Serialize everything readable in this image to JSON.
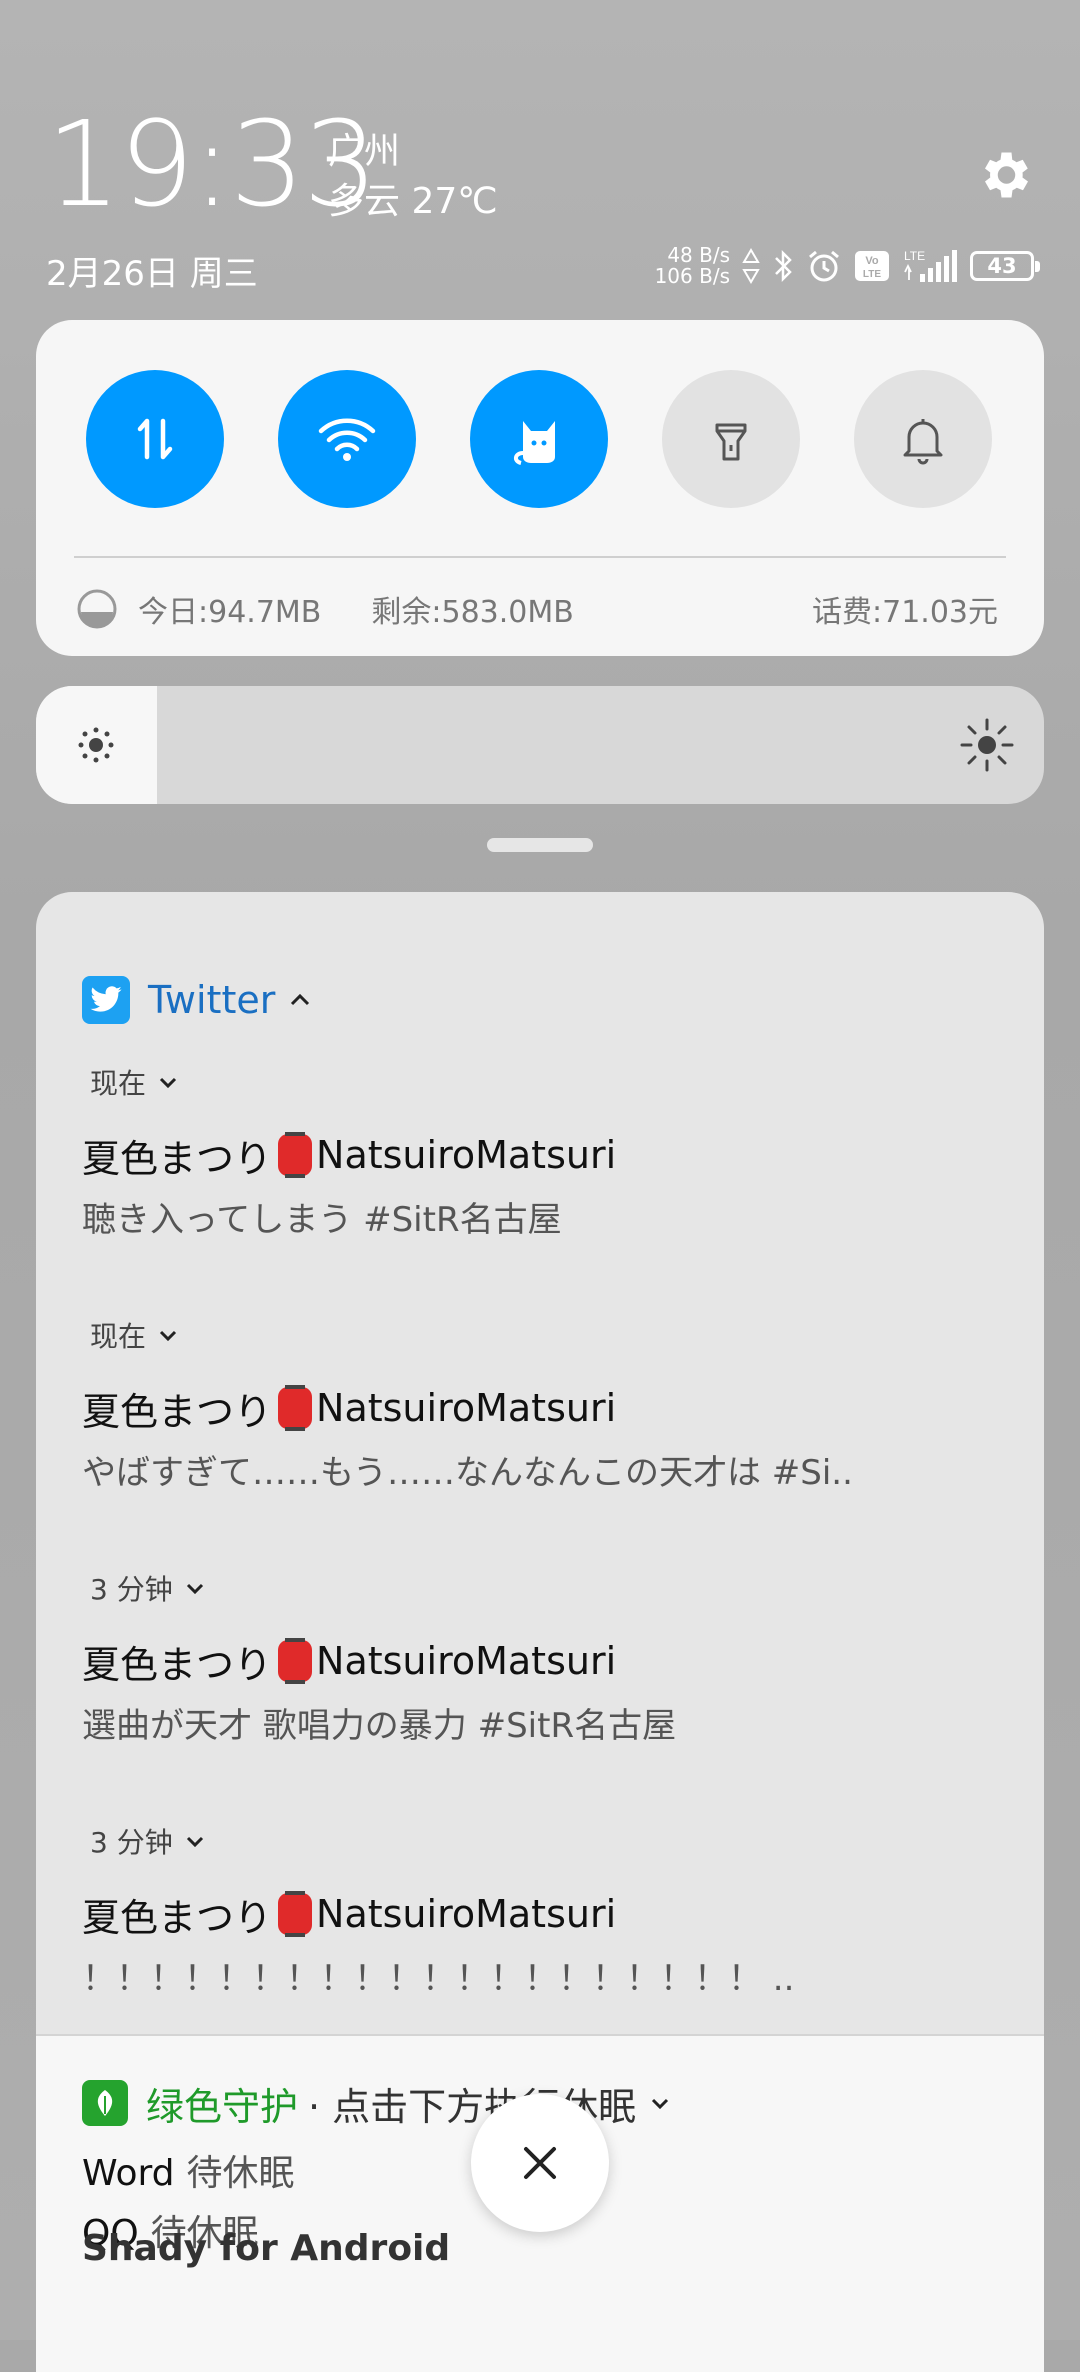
{
  "header": {
    "time": "19:33",
    "city": "广州",
    "weather": "多云 27℃",
    "date": "2月26日 周三",
    "speed_up": "48 B/s",
    "speed_down": "106 B/s",
    "network_label": "LTE",
    "battery": "43"
  },
  "toggles": [
    {
      "name": "mobile-data",
      "icon": "data-arrows-icon",
      "state": "on"
    },
    {
      "name": "wifi",
      "icon": "wifi-icon",
      "state": "on"
    },
    {
      "name": "cat-app",
      "icon": "cat-icon",
      "state": "on"
    },
    {
      "name": "flashlight",
      "icon": "flashlight-icon",
      "state": "off"
    },
    {
      "name": "notifications",
      "icon": "bell-icon",
      "state": "off"
    }
  ],
  "usage": {
    "today": "今日:94.7MB",
    "remaining": "剩余:583.0MB",
    "fee": "话费:71.03元"
  },
  "brightness": {
    "level": 0.12
  },
  "twitter": {
    "app_name": "Twitter",
    "notifications": [
      {
        "time": "现在",
        "author_a": "夏色まつり",
        "author_b": "NatsuiroMatsuri",
        "body": "聴き入ってしまう #SitR名古屋"
      },
      {
        "time": "现在",
        "author_a": "夏色まつり",
        "author_b": "NatsuiroMatsuri",
        "body": "やばすぎて……もう……なんなんこの天才は #Si.."
      },
      {
        "time": "3 分钟",
        "author_a": "夏色まつり",
        "author_b": "NatsuiroMatsuri",
        "body": "選曲が天才 歌唱力の暴力 #SitR名古屋"
      },
      {
        "time": "3 分钟",
        "author_a": "夏色まつり",
        "author_b": "NatsuiroMatsuri",
        "body": "！！！！！！！！！！！！！！！！！！！！ .."
      }
    ]
  },
  "green_guard": {
    "app_name": "绿色守护",
    "subtitle": "· 点击下方执行休眠",
    "items": [
      {
        "app": "Word",
        "status": "待休眠"
      },
      {
        "app": "QQ",
        "status": "待休眠"
      }
    ]
  },
  "partial_next": "Shady for Android"
}
